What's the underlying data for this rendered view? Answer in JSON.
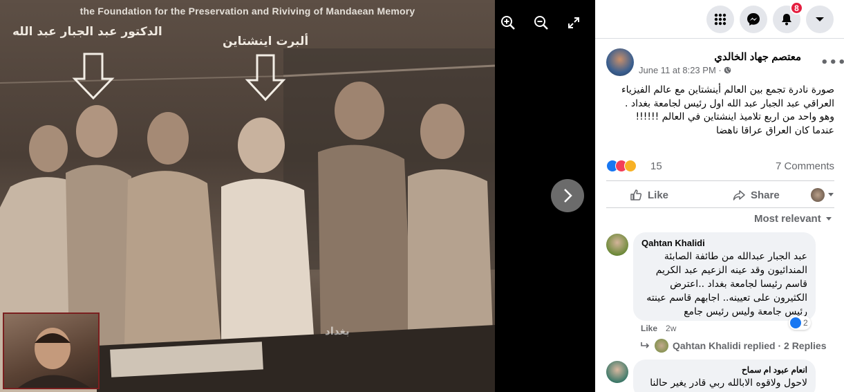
{
  "viewer": {
    "caption": "the Foundation for the Preservation and Riviving of Mandaean Memory",
    "label_left": "الدكتور عبد الجبار عبد الله",
    "label_center": "ألبرت اينشتاين",
    "watermark": "بغداد"
  },
  "topbar": {
    "notifications_badge": "8"
  },
  "post": {
    "author": "معتصم جهاد الخالدي",
    "meta": "June 11 at 8:23 PM · ",
    "text_lines": [
      "صورة نادرة تجمع بين العالم أينشتاين مع عالم الفيزياء",
      "العراقي عبد الجبار عبد الله اول رئيس لجامعة بغداد .",
      "وهو واحد من اربع تلاميذ اينشتاين في العالم !!!!!!",
      "عندما كان العراق عراقا ناهضا"
    ],
    "reaction_count": "15",
    "comments_count": "7 Comments",
    "like_label": "Like",
    "share_label": "Share"
  },
  "sort_label": "Most relevant",
  "comments": [
    {
      "author": "Qahtan Khalidi",
      "lines": [
        "عبد الجبار عبدالله من طائفة الصابئة",
        "المندائيون وقد عينه الزعيم عبد الكريم",
        "قاسم رئيسا لجامعة بغداد ..اعترض",
        "الكثيرون على تعيينه.. اجابهم قاسم عينته",
        "رئيس جامعة وليس رئيس جامع"
      ],
      "like_label": "Like",
      "time": "2w",
      "reactions": "2",
      "replies_label": "Qahtan Khalidi replied · 2 Replies"
    },
    {
      "author": "انعام عبود ام سماح",
      "lines": [
        "لاحول ولاقوه الابالله ربي قادر يغير حالنا"
      ]
    }
  ]
}
